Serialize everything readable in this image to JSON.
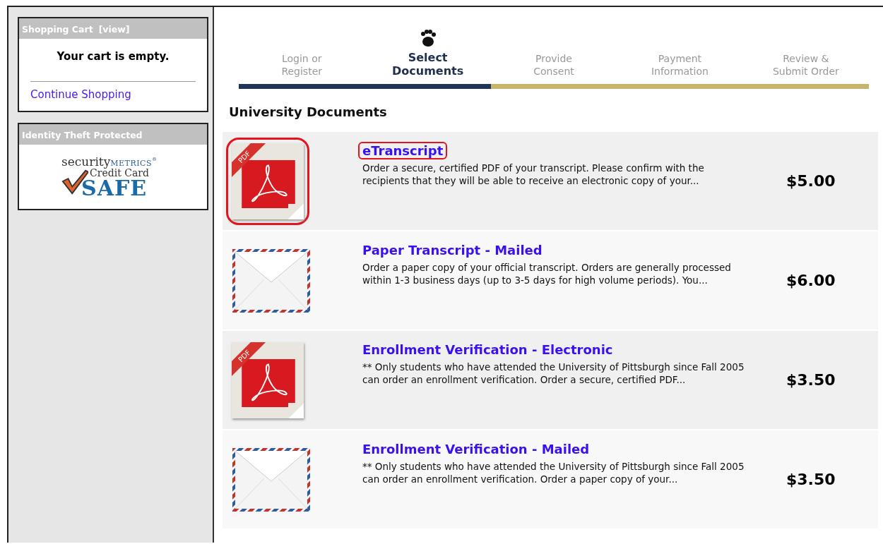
{
  "sidebar": {
    "cart": {
      "title": "Shopping Cart",
      "view_link": "[view]",
      "message": "Your cart is empty.",
      "link": "Continue Shopping"
    },
    "protection": {
      "title": "Identity Theft Protected",
      "badge": {
        "brand_1": "security",
        "brand_2": "METRICS",
        "brand_mark": "®",
        "line_2": "Credit Card",
        "line_3": "SAFE"
      }
    }
  },
  "steps": [
    {
      "label": "Login or\nRegister",
      "selected": false
    },
    {
      "label": "Select\nDocuments",
      "selected": true
    },
    {
      "label": "Provide\nConsent",
      "selected": false
    },
    {
      "label": "Payment\nInformation",
      "selected": false
    },
    {
      "label": "Review &\nSubmit Order",
      "selected": false
    }
  ],
  "progress": {
    "level": 0.4
  },
  "section_title": "University Documents",
  "documents": [
    {
      "kind": "pdf",
      "icon_label": "PDF",
      "title": "eTranscript",
      "highlighted": true,
      "description": "Order a secure, certified PDF of your transcript. Please confirm with the recipients that they will be able to receive an electronic copy of your...",
      "price": "$5.00"
    },
    {
      "kind": "mail",
      "title": "Paper Transcript - Mailed",
      "highlighted": false,
      "description": "Order a paper copy of your official transcript. Orders are generally processed within 1-3 business days (up to 3-5 days for high volume periods). You...",
      "price": "$6.00"
    },
    {
      "kind": "pdf",
      "icon_label": "PDF",
      "title": "Enrollment Verification - Electronic",
      "highlighted": false,
      "description": "** Only students who have attended the University of Pittsburgh since Fall 2005 can order an enrollment verification. Order a secure, certified PDF...",
      "price": "$3.50"
    },
    {
      "kind": "mail",
      "title": "Enrollment Verification - Mailed",
      "highlighted": false,
      "description": "** Only students who have attended the University of Pittsburgh since Fall 2005 can order an enrollment verification. Order a paper copy of your...",
      "price": "$3.50"
    }
  ]
}
